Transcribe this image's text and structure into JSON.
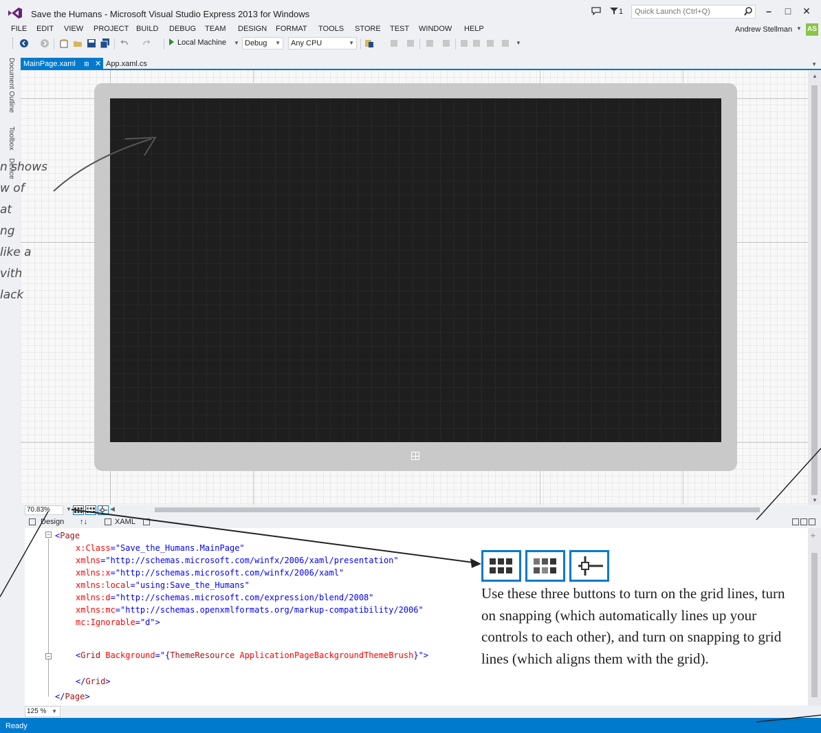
{
  "window": {
    "title": "Save the Humans - Microsoft Visual Studio Express 2013 for Windows",
    "notification_count": "1",
    "quick_launch_placeholder": "Quick Launch (Ctrl+Q)"
  },
  "menu": {
    "items": [
      "FILE",
      "EDIT",
      "VIEW",
      "PROJECT",
      "BUILD",
      "DEBUG",
      "TEAM",
      "DESIGN",
      "FORMAT",
      "TOOLS",
      "STORE",
      "TEST",
      "WINDOW",
      "HELP"
    ],
    "user_name": "Andrew Stellman",
    "user_initials": "AS"
  },
  "toolbar": {
    "run_target": "Local Machine",
    "configuration": "Debug",
    "platform": "Any CPU"
  },
  "tabs": {
    "active": "MainPage.xaml",
    "inactive": "App.xaml.cs"
  },
  "side_rail": [
    "Document Outline",
    "Toolbox",
    "Device"
  ],
  "designer": {
    "zoom": "70.83%"
  },
  "split": {
    "design_tab": "Design",
    "swap": "↑↓",
    "xaml_tab": "XAML"
  },
  "xaml": {
    "lines": {
      "l0": {
        "bracket": "<",
        "tag": "Page"
      },
      "l1": {
        "attr": "x:Class",
        "value": "\"Save_the_Humans.MainPage\""
      },
      "l2": {
        "attr": "xmlns",
        "value": "\"http://schemas.microsoft.com/winfx/2006/xaml/presentation\""
      },
      "l3": {
        "attr": "xmlns:x",
        "value": "\"http://schemas.microsoft.com/winfx/2006/xaml\""
      },
      "l4": {
        "attr": "xmlns:local",
        "value": "\"using:Save_the_Humans\""
      },
      "l5": {
        "attr": "xmlns:d",
        "value": "\"http://schemas.microsoft.com/expression/blend/2008\""
      },
      "l6": {
        "attr": "xmlns:mc",
        "value": "\"http://schemas.openxmlformats.org/markup-compatibility/2006\""
      },
      "l7": {
        "attr": "mc:Ignorable",
        "value": "\"d\"",
        "close": ">"
      },
      "l8": {
        "bracket": "<",
        "tag": "Grid",
        "attr": "Background",
        "value_open": "=\"{",
        "value_tag": "ThemeResource",
        "value_attr": "ApplicationPageBackgroundThemeBrush",
        "value_close": "}\">"
      },
      "l9": {
        "bracket": "</",
        "tag": "Grid",
        "close": ">"
      },
      "l10": {
        "bracket": "</",
        "tag": "Page",
        "close": ">"
      }
    },
    "editor_zoom": "125 %"
  },
  "status": {
    "text": "Ready"
  },
  "annotations": {
    "handwritten_lines": [
      "n shows",
      "w of",
      "at",
      "ng",
      "like a",
      "vith",
      "lack"
    ],
    "callout": "Use these three buttons to turn on the grid lines, turn on snapping (which automatically lines up your controls to each other), and turn on snapping to grid lines (which aligns them with the grid)."
  },
  "icons": {
    "logo": "visual-studio-logo-icon",
    "accent": "#007acc",
    "logo_color": "#68217a"
  }
}
